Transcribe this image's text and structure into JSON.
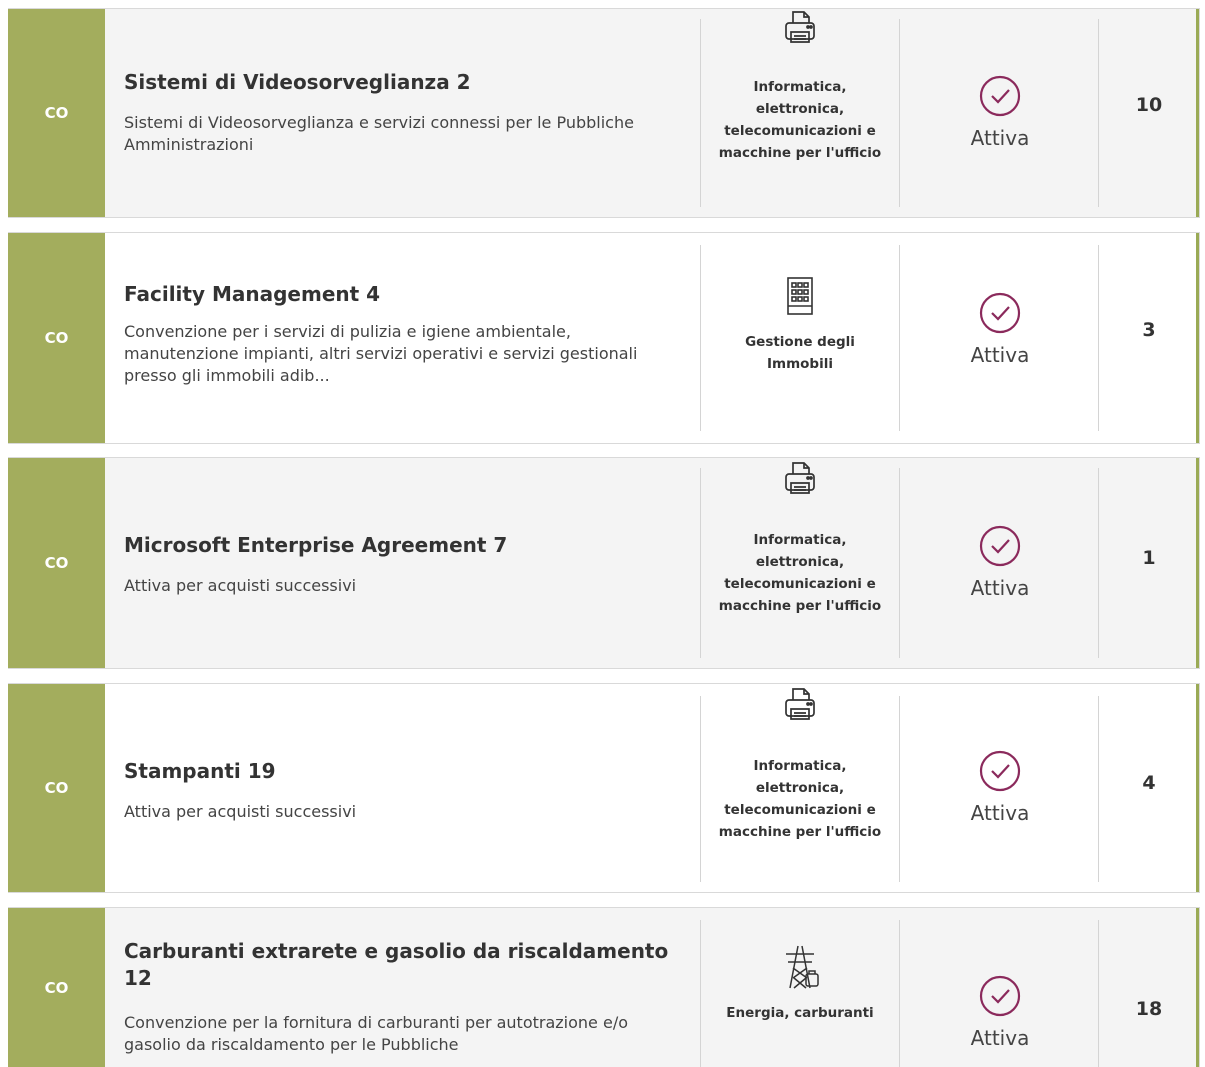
{
  "theme": {
    "accent": "#a3ad5d",
    "status_color": "#8b2a5c"
  },
  "cards": [
    {
      "tag": "CO",
      "title": "Sistemi di Videosorveglianza 2",
      "description": "Sistemi di Videosorveglianza e servizi connessi per le Pubbliche Amministrazioni",
      "category_icon": "printer-icon",
      "category": "Informatica, elettronica, telecomunicazioni e macchine per l'ufficio",
      "status": "Attiva",
      "count": "10"
    },
    {
      "tag": "CO",
      "title": "Facility Management 4",
      "description": "Convenzione per i servizi di pulizia e igiene ambientale, manutenzione impianti, altri servizi operativi e servizi gestionali presso gli immobili adib...",
      "category_icon": "building-icon",
      "category": "Gestione degli Immobili",
      "status": "Attiva",
      "count": "3"
    },
    {
      "tag": "CO",
      "title": "Microsoft Enterprise Agreement 7",
      "description": "Attiva per acquisti successivi",
      "category_icon": "printer-icon",
      "category": "Informatica, elettronica, telecomunicazioni e macchine per l'ufficio",
      "status": "Attiva",
      "count": "1"
    },
    {
      "tag": "CO",
      "title": "Stampanti 19",
      "description": "Attiva per acquisti successivi",
      "category_icon": "printer-icon",
      "category": "Informatica, elettronica, telecomunicazioni e macchine per l'ufficio",
      "status": "Attiva",
      "count": "4"
    },
    {
      "tag": "CO",
      "title": "Carburanti extrarete e gasolio da riscaldamento 12",
      "description": "Convenzione per la fornitura di carburanti per autotrazione e/o gasolio da riscaldamento per le Pubbliche",
      "category_icon": "power-tower-icon",
      "category": "Energia, carburanti",
      "status": "Attiva",
      "count": "18"
    }
  ]
}
